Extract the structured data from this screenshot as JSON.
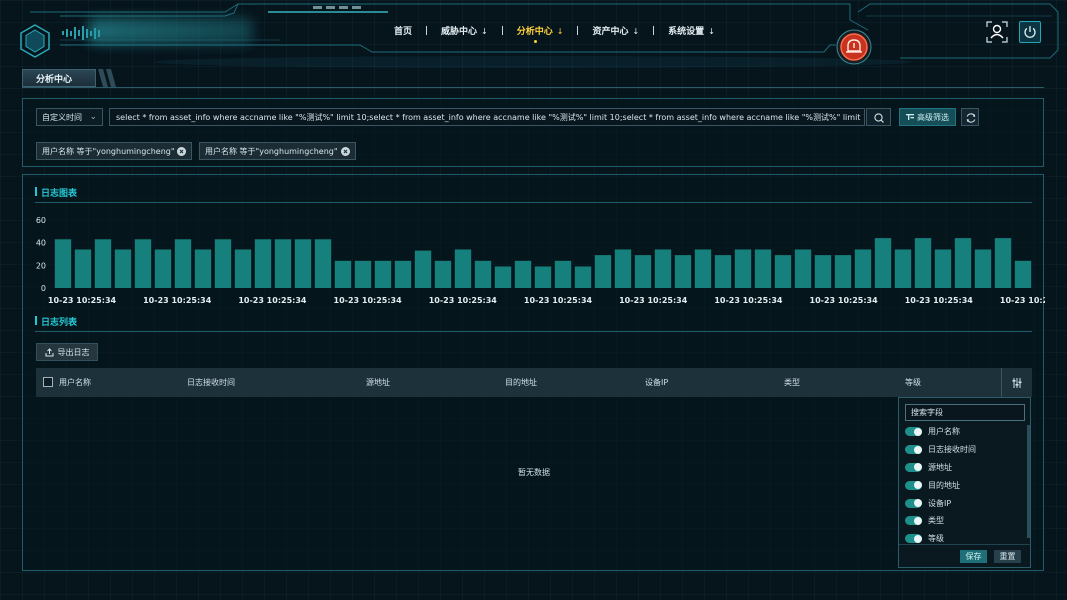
{
  "header": {
    "nav": [
      {
        "label": "首页",
        "has_arrow": false,
        "active": false
      },
      {
        "label": "威胁中心",
        "has_arrow": true,
        "active": false
      },
      {
        "label": "分析中心",
        "has_arrow": true,
        "active": true
      },
      {
        "label": "资产中心",
        "has_arrow": true,
        "active": false
      },
      {
        "label": "系统设置",
        "has_arrow": true,
        "active": false
      }
    ],
    "arrow_glyph": "↓",
    "icons": {
      "logo": "hexagon-logo-icon",
      "alarm": "alarm-bell-icon",
      "user": "user-icon",
      "power": "power-icon"
    }
  },
  "page_title": "分析中心",
  "query": {
    "time_range": "自定义时间",
    "sql": "select * from asset_info where accname like \"%测试%\" limit 10;select * from asset_info where accname like \"%测试%\" limit 10;select * from asset_info where accname like \"%测试%\" limit 10;",
    "advanced_filter_label": "高级筛选",
    "filters": [
      "用户名称 等于\"yonghumingcheng\"",
      "用户名称 等于\"yonghumingcheng\""
    ]
  },
  "log_chart_title": "日志图表",
  "chart_data": {
    "type": "bar",
    "ylim": [
      0,
      60
    ],
    "yticks": [
      0,
      20,
      40,
      60
    ],
    "values": [
      43,
      34,
      43,
      34,
      43,
      34,
      43,
      34,
      43,
      34,
      43,
      43,
      43,
      43,
      24,
      24,
      24,
      24,
      33,
      24,
      34,
      24,
      19,
      24,
      19,
      24,
      19,
      29,
      34,
      29,
      34,
      29,
      34,
      29,
      34,
      34,
      29,
      34,
      29,
      29,
      34,
      44,
      34,
      44,
      34,
      44,
      34,
      44,
      24
    ],
    "x_tick_labels": [
      "10-23 10:25:34",
      "10-23 10:25:34",
      "10-23 10:25:34",
      "10-23 10:25:34",
      "10-23 10:25:34",
      "10-23 10:25:34",
      "10-23 10:25:34",
      "10-23 10:25:34",
      "10-23 10:25:34",
      "10-23 10:25:34",
      "10-23 10:25:34"
    ],
    "bar_color": "#16807c",
    "title": "",
    "xlabel": "",
    "ylabel": ""
  },
  "log_list": {
    "title": "日志列表",
    "export_label": "导出日志",
    "columns": [
      "用户名称",
      "日志接收时间",
      "源地址",
      "目的地址",
      "设备IP",
      "类型",
      "等级"
    ],
    "empty_text": "暂无数据"
  },
  "column_picker": {
    "search_placeholder": "搜索字段",
    "fields": [
      "用户名称",
      "日志接收时间",
      "源地址",
      "目的地址",
      "设备IP",
      "类型",
      "等级"
    ],
    "save_label": "保存",
    "reset_label": "重置"
  },
  "colors": {
    "accent": "#25c9d6",
    "active_nav": "#ffd23a",
    "alarm": "#e8402c"
  }
}
